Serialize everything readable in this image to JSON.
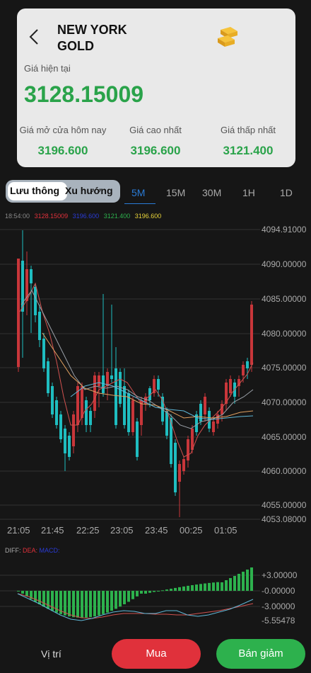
{
  "header": {
    "title": "NEW YORK\nGOLD",
    "current_label": "Giá hiện tại",
    "current_price": "3128.15009",
    "stats": [
      {
        "label": "Giá mở cửa hôm nay",
        "value": "3196.600"
      },
      {
        "label": "Giá cao nhất",
        "value": "3196.600"
      },
      {
        "label": "Giá thấp nhất",
        "value": "3121.400"
      }
    ]
  },
  "modes": {
    "circulation": "Lưu thông",
    "trend": "Xu hướng",
    "active": "Lưu thông"
  },
  "timeframes": [
    "5M",
    "15M",
    "30M",
    "1H",
    "1D"
  ],
  "active_timeframe": "5M",
  "legend": {
    "time": "18:54:00",
    "values": [
      {
        "text": "3128.15009",
        "color": "#e0313b"
      },
      {
        "text": "3196.600",
        "color": "#2a3bd6"
      },
      {
        "text": "3121.400",
        "color": "#2db14d"
      },
      {
        "text": "3196.600",
        "color": "#e8d33a"
      }
    ]
  },
  "chart_data": {
    "type": "candlestick",
    "y_ticks": [
      "4094.91000",
      "4090.00000",
      "4085.00000",
      "4080.00000",
      "4075.00000",
      "4070.00000",
      "4065.00000",
      "4060.00000",
      "4055.00000",
      "4053.08000"
    ],
    "x_ticks": [
      "21:05",
      "21:45",
      "22:25",
      "23:05",
      "23:45",
      "00:25",
      "01:05"
    ],
    "ylim": [
      4053.08,
      4094.91
    ],
    "colors": {
      "up": "#c8363a",
      "down": "#1fbdc0",
      "ma1": "#d0514f",
      "ma2": "#9aa0a8",
      "ma3": "#e0a060",
      "ma4": "#5fb8d8"
    }
  },
  "macd": {
    "labels": {
      "diff": "DIFF:",
      "dea": "DEA:",
      "macd": "MACD:"
    },
    "label_colors": {
      "diff": "#aaa",
      "dea": "#e0313b",
      "macd": "#2a3bd6"
    },
    "y_ticks": [
      "+3.00000",
      "-0.00000",
      "-3.00000",
      "-5.55478"
    ]
  },
  "footer": {
    "position": "Vị trí",
    "buy": "Mua",
    "sell": "Bán giảm"
  }
}
